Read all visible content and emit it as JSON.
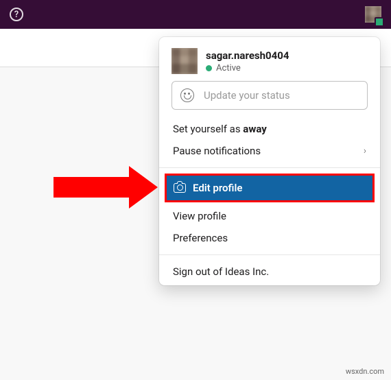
{
  "header": {
    "username": "sagar.naresh0404",
    "presence_label": "Active"
  },
  "status": {
    "placeholder": "Update your status"
  },
  "menu": {
    "away_prefix": "Set yourself as ",
    "away_strong": "away",
    "pause": "Pause notifications",
    "edit_profile": "Edit profile",
    "view_profile": "View profile",
    "preferences": "Preferences",
    "signout": "Sign out of Ideas Inc."
  },
  "watermark": "wsxdn.com"
}
